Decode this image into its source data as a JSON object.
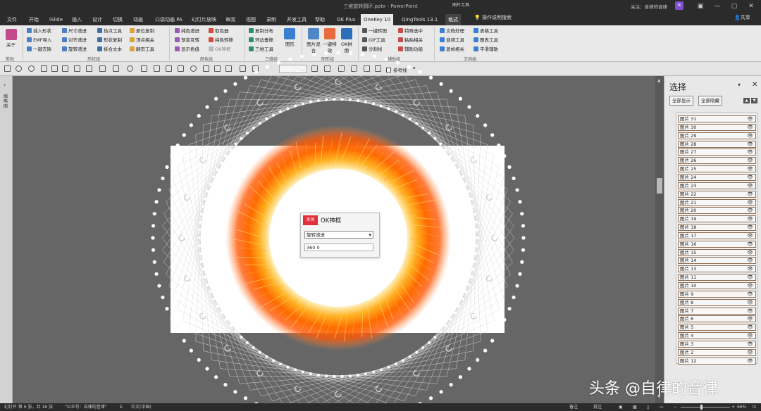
{
  "window": {
    "title": "三维旋转圆环.pptx  -  PowerPoint",
    "context_label": "图片工具",
    "user": "关注：自律的音律",
    "avatar": "ik",
    "min": "—",
    "max": "▢",
    "close": "✕"
  },
  "tabs": [
    "文件",
    "开始",
    "iSlide",
    "插入",
    "设计",
    "切换",
    "动画",
    "口袋动画 PA",
    "幻灯片放映",
    "审阅",
    "视图",
    "录制",
    "开发工具",
    "帮助",
    "OK Plus",
    "OneKey 10",
    "QingTools 13.1",
    "格式"
  ],
  "active_tab": "OneKey 10",
  "tell_me": "操作说明搜索",
  "share": "共享",
  "ribbon": {
    "about": "关于",
    "shape_items": [
      "插入形状",
      "尺寸递进",
      "拾点工具",
      "原位复制",
      "EMF导入",
      "对齐递进",
      "形状复制",
      "顶点相关",
      "一键去除",
      "旋转递进",
      "拆合文本",
      "翻页工具"
    ],
    "color_items": [
      "纯色递进",
      "取色器",
      "渐变互转",
      "纯色转移",
      "显示色值",
      "OK神框"
    ],
    "3d_items": [
      "复制分布",
      "图形",
      "图片混合",
      "一键转存",
      "环边垂移",
      "三维工具",
      "一键特效",
      "OK拼图"
    ],
    "aux_items": [
      "一键转图",
      "特殊选中",
      "GIF工具",
      "粘贴相关",
      "分割线",
      "辅助功能"
    ],
    "doc_items": [
      "文档处理",
      "表格工具",
      "音频工具",
      "图表工具",
      "遮帧相关",
      "平滑辅助"
    ],
    "groups": [
      "剪贴",
      "形状组",
      "颜色组",
      "三维组",
      "图形组",
      "辅助组",
      "文档组"
    ]
  },
  "qat": {
    "ref_line": "参考线"
  },
  "left_panel": {
    "arrow": "›",
    "label": "缩略图"
  },
  "dialog": {
    "close": "关闭",
    "title": "OK神框",
    "select": "旋转递进",
    "value": "360 0"
  },
  "selection_pane": {
    "title": "选择",
    "show_all": "全部显示",
    "hide_all": "全部隐藏",
    "items": [
      "图片 31",
      "图片 30",
      "图片 29",
      "图片 28",
      "图片 27",
      "图片 26",
      "图片 25",
      "图片 24",
      "图片 23",
      "图片 22",
      "图片 21",
      "图片 20",
      "图片 19",
      "图片 18",
      "图片 17",
      "图片 16",
      "图片 15",
      "图片 14",
      "图片 13",
      "图片 11",
      "图片 10",
      "图片 9",
      "图片 8",
      "图片 7",
      "图片 6",
      "图片 5",
      "图片 4",
      "图片 3",
      "图片 2",
      "图片 12"
    ]
  },
  "status": {
    "slide": "幻灯片 第 6 张，共 16 张",
    "account": "\"公众号：自律的音律\"",
    "lang": "中文(中国)",
    "notes": "备注",
    "comments": "批注",
    "zoom": "66%"
  },
  "watermark": "头条 @自律的音律",
  "colors": {
    "accent": "#e0303a",
    "ring_outer": "#ff6a00",
    "ring_inner": "#ffd050"
  }
}
